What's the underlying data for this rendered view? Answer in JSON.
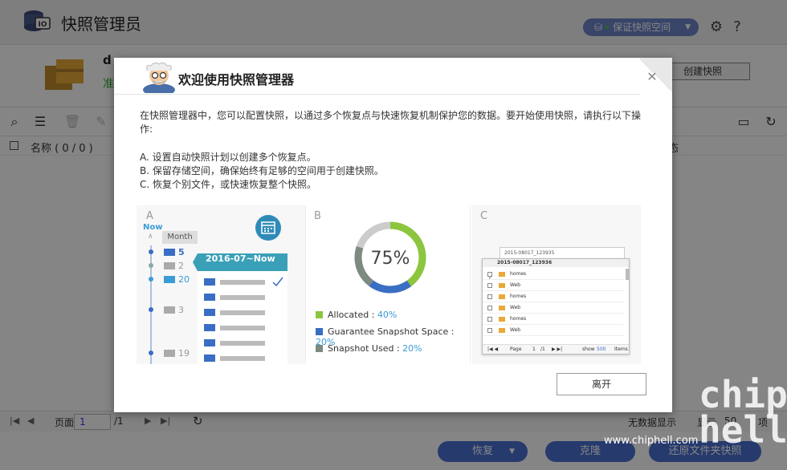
{
  "app": {
    "title": "快照管理员",
    "guarantee_button": "保证快照空间",
    "volume_name": "d",
    "volume_status": "准",
    "create_snapshot": "创建快照",
    "list_header_name": "名称 ( 0 / 0 )",
    "list_header_status": "态"
  },
  "pager": {
    "page_label": "页面",
    "page_value": "1",
    "page_total": "/1",
    "no_data": "无数据显示",
    "show_label": "显示",
    "count": "50",
    "items": "项"
  },
  "footer": {
    "restore": "恢复",
    "clone": "克隆",
    "restore_folder": "还原文件夹快照"
  },
  "modal": {
    "title": "欢迎使用快照管理器",
    "intro": "在快照管理器中，您可以配置快照，以通过多个恢复点与快速恢复机制保护您的数据。要开始使用快照，请执行以下操作:",
    "step_a": "A. 设置自动快照计划以创建多个恢复点。",
    "step_b": "B. 保留存储空间，确保始终有足够的空间用于创建快照。",
    "step_c": "C. 恢复个别文件，或快速恢复整个快照。",
    "leave_button": "离开"
  },
  "panel_a": {
    "letter": "A",
    "now": "Now",
    "month": "Month",
    "range": "2016-07~Now",
    "timeline": [
      "5",
      "2",
      "20",
      "3",
      "19"
    ]
  },
  "panel_b": {
    "letter": "B",
    "percent": "75%",
    "percent_value": 75,
    "legend": [
      {
        "label": "Allocated :",
        "value": "40%",
        "color": "#8cc63f"
      },
      {
        "label": "Guarantee Snapshot Space :",
        "value": "20%",
        "color": "#3a6dc4"
      },
      {
        "label": "Snapshot Used :",
        "value": "20%",
        "color": "#7d8a80"
      }
    ]
  },
  "panel_c": {
    "letter": "C",
    "back_title": "2015-08017_123935",
    "title": "2015-08017_123936",
    "rows": [
      "homes",
      "Web",
      "homes",
      "Web",
      "homes",
      "Web"
    ],
    "page_label": "Page",
    "page_value": "1",
    "page_total": "/1",
    "show": "show",
    "show_value": "500",
    "items": "Items"
  },
  "watermark": {
    "big": "chip hell",
    "url": "www.chiphell.com"
  }
}
